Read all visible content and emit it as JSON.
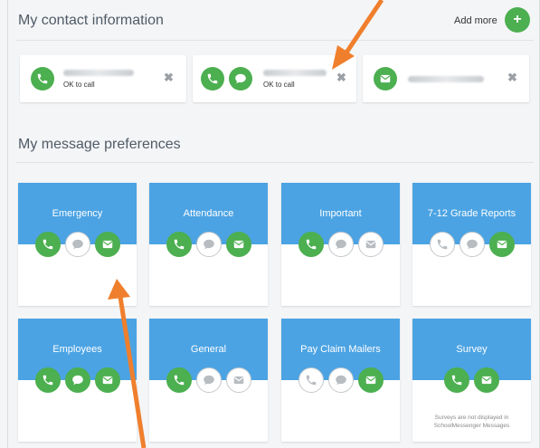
{
  "contact_section": {
    "title": "My contact information",
    "add_more": "Add more",
    "add_icon": "plus-icon",
    "cards": [
      {
        "channels": [
          "phone-icon"
        ],
        "status": "OK to call",
        "remove": "✖"
      },
      {
        "channels": [
          "phone-icon",
          "sms-icon"
        ],
        "status": "OK to call",
        "remove": "✖"
      },
      {
        "channels": [
          "email-icon"
        ],
        "status": "",
        "remove": "✖"
      }
    ]
  },
  "preference_section": {
    "title": "My message preferences",
    "categories": [
      {
        "label": "Emergency",
        "phone": "on",
        "sms": "off",
        "email": "on"
      },
      {
        "label": "Attendance",
        "phone": "on",
        "sms": "off",
        "email": "on"
      },
      {
        "label": "Important",
        "phone": "on",
        "sms": "off",
        "email": "off"
      },
      {
        "label": "7-12 Grade Reports",
        "phone": "off",
        "sms": "off",
        "email": "on"
      },
      {
        "label": "Employees",
        "phone": "on",
        "sms": "on",
        "email": "on"
      },
      {
        "label": "General",
        "phone": "on",
        "sms": "off",
        "email": "off"
      },
      {
        "label": "Pay Claim Mailers",
        "phone": "off",
        "sms": "off",
        "email": "on"
      },
      {
        "label": "Survey",
        "phone": "on",
        "email": "on",
        "note_line1": "Surveys are not displayed in",
        "note_line2": "SchoolMessenger Messages"
      }
    ]
  },
  "colors": {
    "header_blue": "#4ba3e3",
    "on_green": "#4caf50",
    "off_border": "#c4c8cc",
    "annotation_arrow": "#f07f2d"
  }
}
